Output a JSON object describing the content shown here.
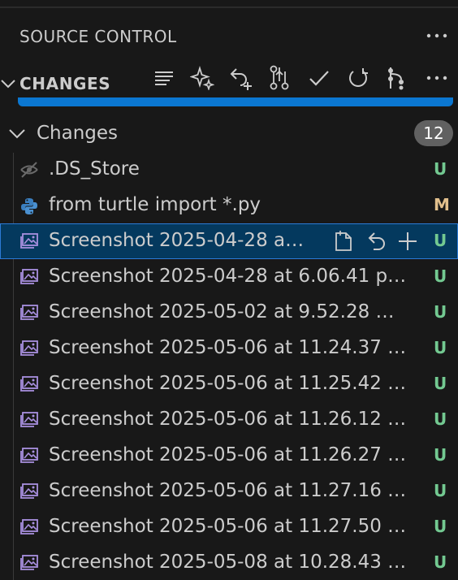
{
  "view": {
    "title": "SOURCE CONTROL",
    "more_icon": "ellipsis-icon"
  },
  "section": {
    "title": "CHANGES",
    "actions": [
      {
        "name": "view-as-list-button",
        "icon": "list-icon"
      },
      {
        "name": "generate-commit-message-button",
        "icon": "sparkle-icon"
      },
      {
        "name": "discard-and-stage-button",
        "icon": "undo-plus-icon"
      },
      {
        "name": "branch-graph-button",
        "icon": "git-compare-icon"
      },
      {
        "name": "commit-button",
        "icon": "check-icon"
      },
      {
        "name": "refresh-button",
        "icon": "refresh-icon"
      },
      {
        "name": "source-graph-button",
        "icon": "git-graph-icon"
      },
      {
        "name": "more-actions-button",
        "icon": "ellipsis-icon"
      }
    ]
  },
  "group": {
    "label": "Changes",
    "count": "12"
  },
  "files": [
    {
      "name": ".DS_Store",
      "status": "U",
      "icon": "eye-closed-icon"
    },
    {
      "name": "from turtle import *.py",
      "status": "M",
      "icon": "python-icon"
    },
    {
      "name": "Screenshot 2025-04-28 a…",
      "status": "U",
      "icon": "image-icon",
      "selected": true
    },
    {
      "name": "Screenshot 2025-04-28 at 6.06.41 p…",
      "status": "U",
      "icon": "image-icon"
    },
    {
      "name": "Screenshot 2025-05-02 at 9.52.28 …",
      "status": "U",
      "icon": "image-icon"
    },
    {
      "name": "Screenshot 2025-05-06 at 11.24.37 …",
      "status": "U",
      "icon": "image-icon"
    },
    {
      "name": "Screenshot 2025-05-06 at 11.25.42 …",
      "status": "U",
      "icon": "image-icon"
    },
    {
      "name": "Screenshot 2025-05-06 at 11.26.12 …",
      "status": "U",
      "icon": "image-icon"
    },
    {
      "name": "Screenshot 2025-05-06 at 11.26.27 …",
      "status": "U",
      "icon": "image-icon"
    },
    {
      "name": "Screenshot 2025-05-06 at 11.27.16 …",
      "status": "U",
      "icon": "image-icon"
    },
    {
      "name": "Screenshot 2025-05-06 at 11.27.50 …",
      "status": "U",
      "icon": "image-icon"
    },
    {
      "name": "Screenshot 2025-05-08 at 10.28.43 …",
      "status": "U",
      "icon": "image-icon"
    }
  ],
  "selected_row_actions": [
    "open-file-icon",
    "discard-icon",
    "stage-plus-icon"
  ],
  "colors": {
    "untracked": "#73c991",
    "modified": "#e2c08d",
    "selection": "#04395e",
    "accent": "#0b77d1"
  }
}
